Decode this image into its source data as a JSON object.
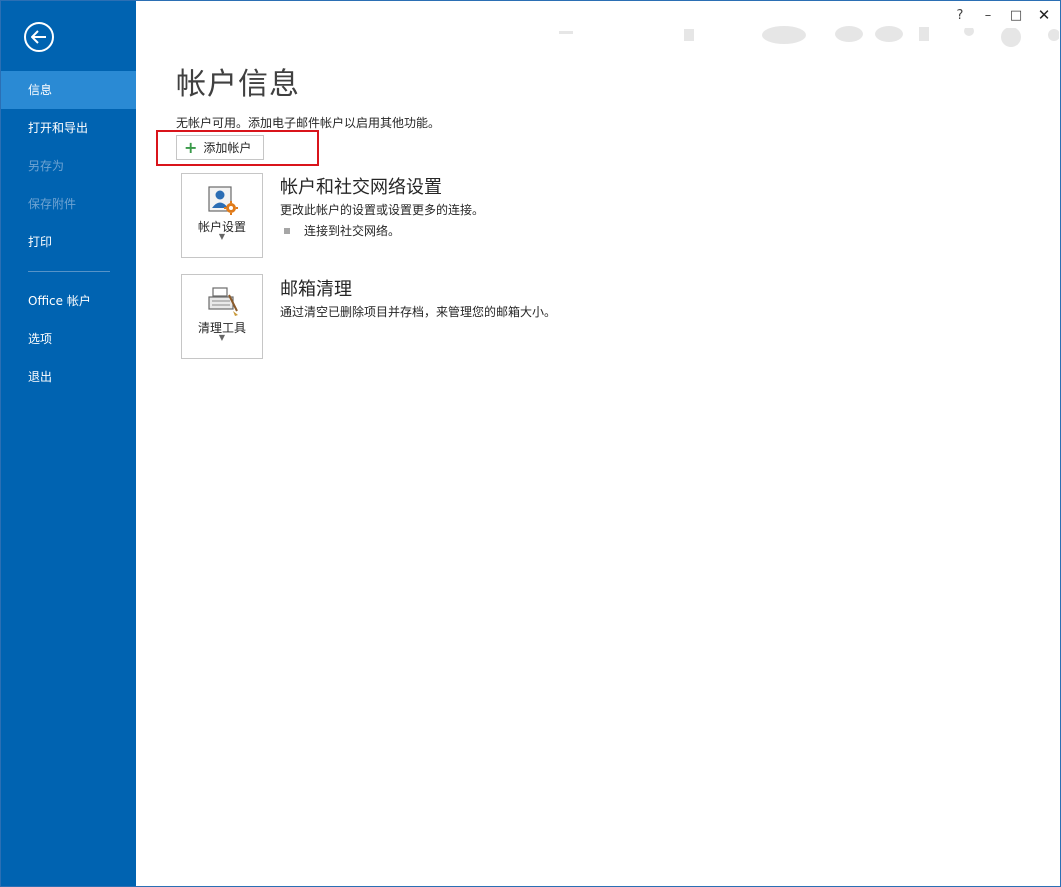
{
  "window": {
    "help_label": "?",
    "minimize_label": "–",
    "maximize_label": "□",
    "close_label": "✕"
  },
  "sidebar": {
    "items": [
      {
        "label": "信息",
        "state": "active"
      },
      {
        "label": "打开和导出",
        "state": "normal"
      },
      {
        "label": "另存为",
        "state": "disabled"
      },
      {
        "label": "保存附件",
        "state": "disabled"
      },
      {
        "label": "打印",
        "state": "normal"
      },
      {
        "label": "Office 帐户",
        "state": "normal"
      },
      {
        "label": "选项",
        "state": "normal"
      },
      {
        "label": "退出",
        "state": "normal"
      }
    ]
  },
  "main": {
    "title": "帐户信息",
    "info_text": "无帐户可用。添加电子邮件帐户以启用其他功能。",
    "add_account_label": "添加帐户",
    "sections": [
      {
        "tile_label": "帐户设置",
        "tile_icon": "account-settings-icon",
        "title": "帐户和社交网络设置",
        "description": "更改此帐户的设置或设置更多的连接。",
        "bullet": "连接到社交网络。"
      },
      {
        "tile_label": "清理工具",
        "tile_icon": "cleanup-tools-icon",
        "title": "邮箱清理",
        "description": "通过清空已删除项目并存档，来管理您的邮箱大小。"
      }
    ]
  },
  "colors": {
    "sidebar_bg": "#0063b1",
    "sidebar_active": "#2a8ad4",
    "highlight_box": "#d9141b",
    "plus_green": "#3a9a4a"
  }
}
